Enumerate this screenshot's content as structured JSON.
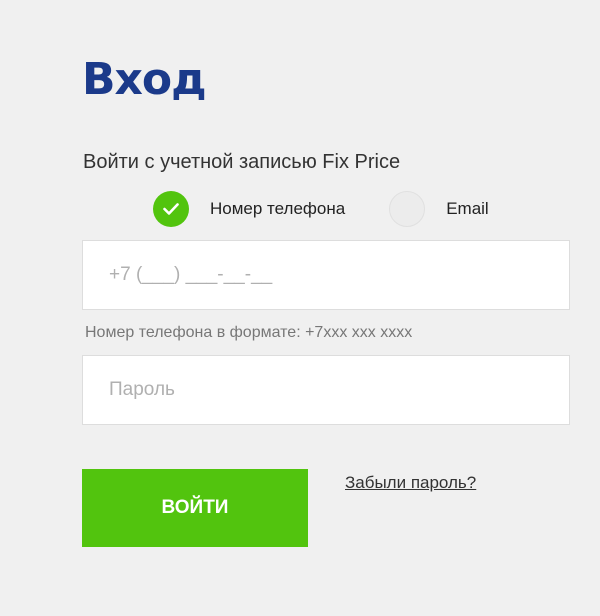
{
  "title": "Вход",
  "subtitle": "Войти с учетной записью Fix Price",
  "login_type": {
    "options": [
      {
        "label": "Номер телефона",
        "selected": true
      },
      {
        "label": "Email",
        "selected": false
      }
    ]
  },
  "phone": {
    "placeholder": "+7 (___) ___-__-__",
    "value": "",
    "hint": "Номер телефона в формате: +7xxx xxx xxxx"
  },
  "password": {
    "placeholder": "Пароль",
    "value": ""
  },
  "login_button_label": "ВОЙТИ",
  "forgot_password_label": "Забыли пароль?",
  "colors": {
    "title": "#1b3a8a",
    "accent_green": "#52c40e",
    "background": "#f0f0f0"
  }
}
